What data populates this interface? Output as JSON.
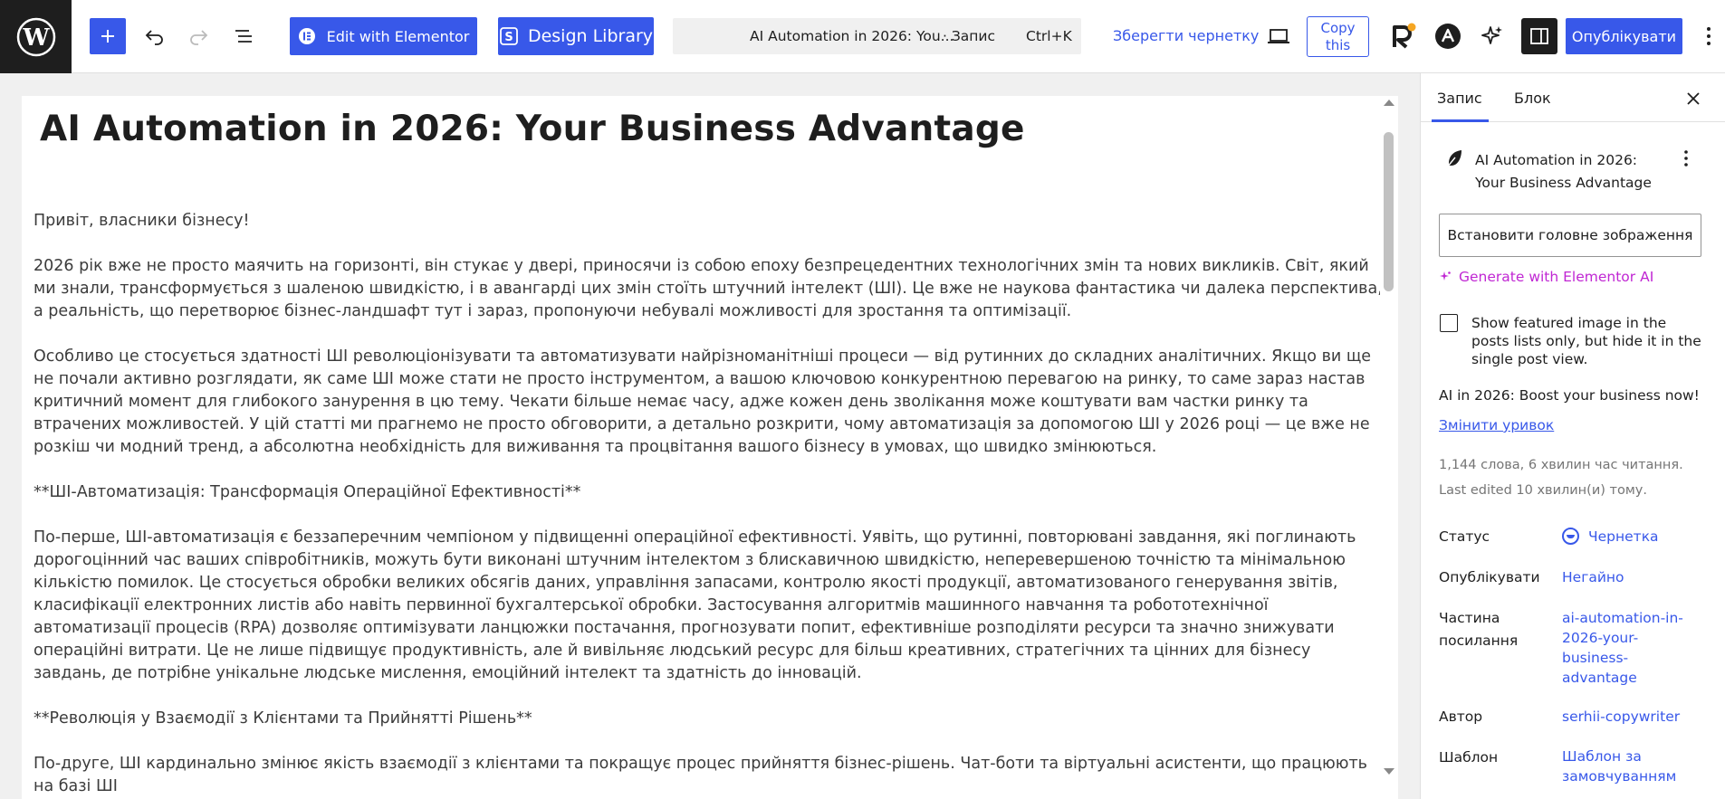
{
  "toolbar": {
    "elementor_label": "Edit with Elementor",
    "design_library_label": "Design Library",
    "command_title": "AI Automation in 2026: You...",
    "command_type": "· Запис",
    "command_shortcut": "Ctrl+K",
    "save_draft_label": "Зберегти чернетку",
    "copy_line1": "Copy",
    "copy_line2": "this",
    "publish_label": "Опублікувати",
    "brand_color": "#3858e9"
  },
  "editor": {
    "title": "AI Automation in 2026: Your Business Advantage",
    "paragraphs": [
      "Привіт, власники бізнесу!",
      "2026 рік вже не просто маячить на горизонті, він стукає у двері, приносячи із собою епоху безпрецедентних технологічних змін та нових викликів. Світ, який ми знали, трансформується з шаленою швидкістю, і в авангарді цих змін стоїть штучний інтелект (ШІ). Це вже не наукова фантастика чи далека перспектива, а реальність, що перетворює бізнес-ландшафт тут і зараз, пропонуючи небувалі можливості для зростання та оптимізації.",
      "Особливо це стосується здатності ШІ революціонізувати та автоматизувати найрізноманітніші процеси — від рутинних до складних аналітичних. Якщо ви ще не почали активно розглядати, як саме ШІ може стати не просто інструментом, а вашою ключовою конкурентною перевагою на ринку, то саме зараз настав критичний момент для глибокого занурення в цю тему. Чекати більше немає часу, адже кожен день зволікання може коштувати вам частки ринку та втрачених можливостей. У цій статті ми прагнемо не просто обговорити, а детально розкрити, чому автоматизація за допомогою ШІ у 2026 році — це вже не розкіш чи модний тренд, а абсолютна необхідність для виживання та процвітання вашого бізнесу в умовах, що швидко змінюються.",
      "**ШІ-Автоматизація: Трансформація Операційної Ефективності**",
      "По-перше, ШІ-автоматизація є беззаперечним чемпіоном у підвищенні операційної ефективності. Уявіть, що рутинні, повторювані завдання, які поглинають дорогоцінний час ваших співробітників, можуть бути виконані штучним інтелектом з блискавичною швидкістю, неперевершеною точністю та мінімальною кількістю помилок. Це стосується обробки великих обсягів даних, управління запасами, контролю якості продукції, автоматизованого генерування звітів, класифікації електронних листів або навіть первинної бухгалтерської обробки. Застосування алгоритмів машинного навчання та робототехнічної автоматизації процесів (RPA) дозволяє оптимізувати ланцюжки постачання, прогнозувати попит, ефективніше розподіляти ресурси та значно знижувати операційні витрати. Це не лише підвищує продуктивність, але й вивільняє людський ресурс для більш креативних, стратегічних та цінних для бізнесу завдань, де потрібне унікальне людське мислення, емоційний інтелект та здатність до інновацій.",
      "**Революція у Взаємодії з Клієнтами та Прийнятті Рішень**",
      "По-друге, ШІ кардинально змінює якість взаємодії з клієнтами та покращує процес прийняття бізнес-рішень. Чат-боти та віртуальні асистенти, що працюють на базі ШІ"
    ]
  },
  "sidebar": {
    "tab_post": "Запис",
    "tab_block": "Блок",
    "post_title": "AI Automation in 2026: Your Business Advantage",
    "featured_image_label": "Встановити головне зображення",
    "generate_label": "Generate with Elementor AI",
    "checkbox_label": "Show featured image in the posts lists only, but hide it in the single post view.",
    "excerpt": "AI in 2026: Boost your business now!",
    "edit_excerpt_label": "Змінити уривок",
    "word_count": "1,144 слова, 6 хвилин час читання.",
    "last_edited": "Last edited 10 хвилин(и) тому.",
    "rows": {
      "status_label": "Статус",
      "status_value": "Чернетка",
      "publish_label": "Опублікувати",
      "publish_value": "Негайно",
      "slug_label": "Частина посилання",
      "slug_value": "ai-automation-in-2026-your-business-advantage",
      "author_label": "Автор",
      "author_value": "serhii-copywriter",
      "template_label": "Шаблон",
      "template_value": "Шаблон за замовчуванням"
    }
  },
  "icons": [
    "wordpress-logo-icon",
    "plus-icon",
    "undo-icon",
    "redo-icon",
    "list-view-icon",
    "elementor-icon",
    "design-library-icon",
    "desktop-preview-icon",
    "r-logo-icon",
    "a-logo-icon",
    "sparkle-icon",
    "sidebar-icon",
    "more-vertical-icon",
    "close-icon",
    "feather-icon",
    "draft-status-icon"
  ]
}
